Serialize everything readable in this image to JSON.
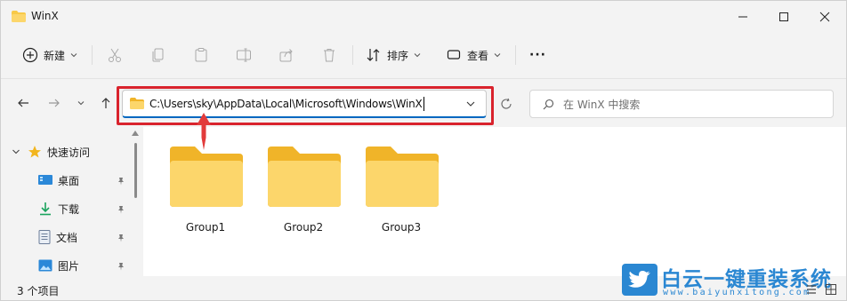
{
  "window": {
    "title": "WinX"
  },
  "toolbar": {
    "new_label": "新建",
    "sort_label": "排序",
    "view_label": "查看",
    "more_label": "···"
  },
  "address": {
    "path": "C:\\Users\\sky\\AppData\\Local\\Microsoft\\Windows\\WinX"
  },
  "search": {
    "placeholder": "在 WinX 中搜索"
  },
  "sidebar": {
    "items": [
      {
        "label": "快速访问"
      },
      {
        "label": "桌面"
      },
      {
        "label": "下载"
      },
      {
        "label": "文档"
      },
      {
        "label": "图片"
      }
    ]
  },
  "folders": [
    {
      "name": "Group1"
    },
    {
      "name": "Group2"
    },
    {
      "name": "Group3"
    }
  ],
  "status": {
    "item_count": "3 个项目"
  },
  "watermark": {
    "brand": "白云一键重装系统",
    "url": "www.baiyunxitong.com"
  },
  "colors": {
    "accent": "#0067c0",
    "highlight": "#d9232d",
    "folder": "#f8c948",
    "brand": "#2a87d2"
  }
}
